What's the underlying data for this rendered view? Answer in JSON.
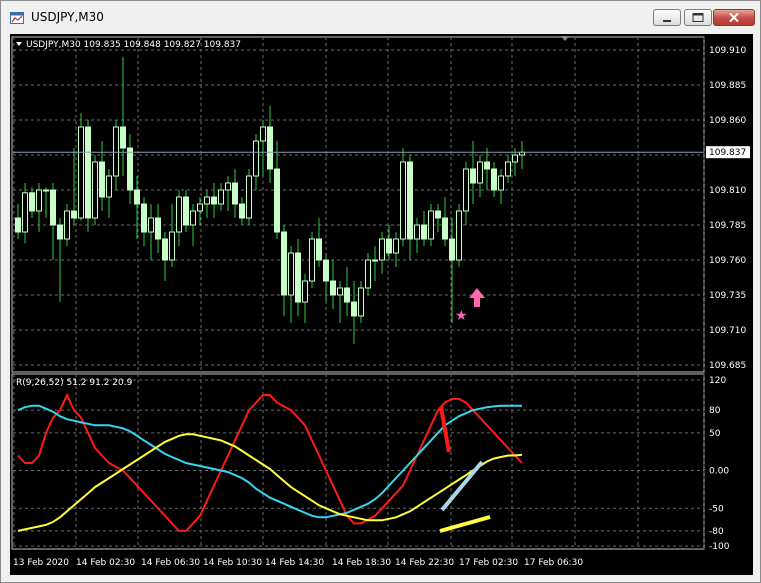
{
  "window": {
    "title": "USDJPY,M30"
  },
  "main_panel": {
    "header": "USDJPY,M30  109.835 109.848 109.827 109.837",
    "price_axis": [
      "109.910",
      "109.885",
      "109.860",
      "109.835",
      "109.810",
      "109.785",
      "109.760",
      "109.735",
      "109.710",
      "109.685"
    ],
    "bid_label": "109.837"
  },
  "indicator_panel": {
    "header": "R(9,26,52) 51.2 91.2 20.9",
    "axis": [
      "120",
      "80",
      "50",
      "0.00",
      "-50",
      "-80",
      "-100"
    ]
  },
  "time_axis": [
    "13 Feb 2020",
    "14 Feb 02:30",
    "14 Feb 06:30",
    "14 Feb 10:30",
    "14 Feb 14:30",
    "14 Feb 18:30",
    "14 Feb 22:30",
    "17 Feb 02:30",
    "17 Feb 06:30"
  ],
  "colors": {
    "background": "#000000",
    "candle": "#c8ffc8",
    "wick": "#2ecc40",
    "grid": "#6b6b6b",
    "indicator_fast": "#ff1a1a",
    "indicator_mid": "#36d6ef",
    "indicator_slow": "#ffff3a",
    "arrow": "#ff69b4"
  },
  "chart_data": [
    {
      "type": "candlestick",
      "title": "USDJPY,M30",
      "ylim": [
        109.685,
        109.91
      ],
      "candles": [
        [
          109.79,
          109.8,
          109.775,
          109.78
        ],
        [
          109.78,
          109.815,
          109.772,
          109.808
        ],
        [
          109.808,
          109.812,
          109.79,
          109.795
        ],
        [
          109.795,
          109.815,
          109.78,
          109.81
        ],
        [
          109.81,
          109.812,
          109.79,
          109.81
        ],
        [
          109.81,
          109.815,
          109.76,
          109.785
        ],
        [
          109.785,
          109.79,
          109.73,
          109.775
        ],
        [
          109.775,
          109.8,
          109.77,
          109.795
        ],
        [
          109.795,
          109.84,
          109.785,
          109.79
        ],
        [
          109.79,
          109.865,
          109.788,
          109.855
        ],
        [
          109.855,
          109.86,
          109.78,
          109.79
        ],
        [
          109.79,
          109.835,
          109.785,
          109.83
        ],
        [
          109.83,
          109.845,
          109.795,
          109.805
        ],
        [
          109.805,
          109.825,
          109.79,
          109.82
        ],
        [
          109.82,
          109.86,
          109.81,
          109.855
        ],
        [
          109.855,
          109.905,
          109.82,
          109.84
        ],
        [
          109.84,
          109.85,
          109.8,
          109.81
        ],
        [
          109.81,
          109.82,
          109.775,
          109.8
        ],
        [
          109.8,
          109.805,
          109.77,
          109.78
        ],
        [
          109.78,
          109.8,
          109.76,
          109.79
        ],
        [
          109.79,
          109.8,
          109.765,
          109.775
        ],
        [
          109.775,
          109.78,
          109.745,
          109.76
        ],
        [
          109.76,
          109.8,
          109.755,
          109.78
        ],
        [
          109.78,
          109.81,
          109.77,
          109.805
        ],
        [
          109.805,
          109.81,
          109.78,
          109.785
        ],
        [
          109.785,
          109.8,
          109.77,
          109.795
        ],
        [
          109.795,
          109.805,
          109.785,
          109.8
        ],
        [
          109.8,
          109.81,
          109.79,
          109.805
        ],
        [
          109.805,
          109.815,
          109.79,
          109.8
        ],
        [
          109.8,
          109.815,
          109.795,
          109.81
        ],
        [
          109.81,
          109.82,
          109.795,
          109.815
        ],
        [
          109.815,
          109.825,
          109.79,
          109.8
        ],
        [
          109.8,
          109.805,
          109.785,
          109.79
        ],
        [
          109.79,
          109.825,
          109.785,
          109.82
        ],
        [
          109.82,
          109.85,
          109.81,
          109.845
        ],
        [
          109.845,
          109.86,
          109.82,
          109.855
        ],
        [
          109.855,
          109.87,
          109.815,
          109.825
        ],
        [
          109.825,
          109.845,
          109.775,
          109.78
        ],
        [
          109.78,
          109.785,
          109.72,
          109.735
        ],
        [
          109.735,
          109.77,
          109.715,
          109.765
        ],
        [
          109.765,
          109.775,
          109.72,
          109.73
        ],
        [
          109.73,
          109.75,
          109.715,
          109.745
        ],
        [
          109.745,
          109.78,
          109.74,
          109.775
        ],
        [
          109.775,
          109.79,
          109.755,
          109.76
        ],
        [
          109.76,
          109.765,
          109.73,
          109.745
        ],
        [
          109.745,
          109.76,
          109.725,
          109.735
        ],
        [
          109.735,
          109.745,
          109.715,
          109.74
        ],
        [
          109.74,
          109.755,
          109.72,
          109.73
        ],
        [
          109.73,
          109.745,
          109.7,
          109.72
        ],
        [
          109.72,
          109.745,
          109.715,
          109.74
        ],
        [
          109.74,
          109.765,
          109.735,
          109.76
        ],
        [
          109.76,
          109.77,
          109.745,
          109.76
        ],
        [
          109.76,
          109.78,
          109.75,
          109.775
        ],
        [
          109.775,
          109.785,
          109.76,
          109.765
        ],
        [
          109.765,
          109.78,
          109.755,
          109.775
        ],
        [
          109.775,
          109.84,
          109.77,
          109.83
        ],
        [
          109.83,
          109.835,
          109.76,
          109.775
        ],
        [
          109.775,
          109.79,
          109.765,
          109.785
        ],
        [
          109.785,
          109.795,
          109.77,
          109.775
        ],
        [
          109.775,
          109.8,
          109.77,
          109.795
        ],
        [
          109.795,
          109.8,
          109.78,
          109.79
        ],
        [
          109.79,
          109.805,
          109.77,
          109.775
        ],
        [
          109.775,
          109.79,
          109.715,
          109.76
        ],
        [
          109.76,
          109.8,
          109.755,
          109.795
        ],
        [
          109.795,
          109.83,
          109.785,
          109.825
        ],
        [
          109.825,
          109.845,
          109.8,
          109.815
        ],
        [
          109.815,
          109.835,
          109.805,
          109.83
        ],
        [
          109.83,
          109.84,
          109.81,
          109.825
        ],
        [
          109.825,
          109.83,
          109.805,
          109.81
        ],
        [
          109.81,
          109.825,
          109.8,
          109.82
        ],
        [
          109.82,
          109.835,
          109.815,
          109.83
        ],
        [
          109.83,
          109.84,
          109.82,
          109.835
        ],
        [
          109.835,
          109.845,
          109.825,
          109.837
        ]
      ]
    },
    {
      "type": "line",
      "title": "R(9,26,52)",
      "ylim": [
        -100,
        120
      ],
      "series": [
        {
          "values": [
            20,
            10,
            10,
            20,
            50,
            70,
            80,
            100,
            80,
            70,
            50,
            30,
            20,
            10,
            5,
            0,
            -10,
            -20,
            -30,
            -40,
            -50,
            -60,
            -70,
            -80,
            -80,
            -70,
            -60,
            -40,
            -20,
            0,
            20,
            40,
            60,
            80,
            90,
            100,
            100,
            90,
            85,
            80,
            70,
            60,
            40,
            20,
            0,
            -20,
            -40,
            -60,
            -70,
            -70,
            -65,
            -60,
            -50,
            -40,
            -30,
            -20,
            0,
            20,
            40,
            60,
            80,
            90,
            95,
            95,
            90,
            80,
            70,
            60,
            50,
            40,
            30,
            20,
            10
          ]
        },
        {
          "values": [
            80,
            84,
            86,
            86,
            82,
            78,
            72,
            68,
            66,
            64,
            62,
            60,
            60,
            60,
            58,
            56,
            52,
            46,
            40,
            34,
            28,
            22,
            18,
            14,
            10,
            8,
            6,
            4,
            2,
            0,
            -2,
            -6,
            -10,
            -16,
            -24,
            -30,
            -36,
            -40,
            -44,
            -48,
            -52,
            -56,
            -60,
            -62,
            -62,
            -60,
            -58,
            -56,
            -52,
            -48,
            -44,
            -38,
            -30,
            -20,
            -10,
            0,
            10,
            20,
            30,
            40,
            50,
            60,
            66,
            72,
            76,
            80,
            82,
            84,
            85,
            86,
            86,
            86,
            86
          ]
        },
        {
          "values": [
            -80,
            -78,
            -76,
            -74,
            -72,
            -68,
            -62,
            -54,
            -46,
            -38,
            -30,
            -22,
            -16,
            -10,
            -4,
            2,
            8,
            14,
            20,
            26,
            32,
            38,
            42,
            46,
            48,
            48,
            46,
            44,
            42,
            40,
            36,
            32,
            26,
            20,
            14,
            8,
            2,
            -6,
            -14,
            -22,
            -28,
            -34,
            -40,
            -46,
            -50,
            -54,
            -58,
            -60,
            -62,
            -64,
            -66,
            -66,
            -66,
            -64,
            -62,
            -58,
            -54,
            -48,
            -42,
            -36,
            -30,
            -24,
            -18,
            -12,
            -6,
            0,
            6,
            12,
            16,
            18,
            20,
            20,
            21
          ]
        }
      ]
    }
  ]
}
